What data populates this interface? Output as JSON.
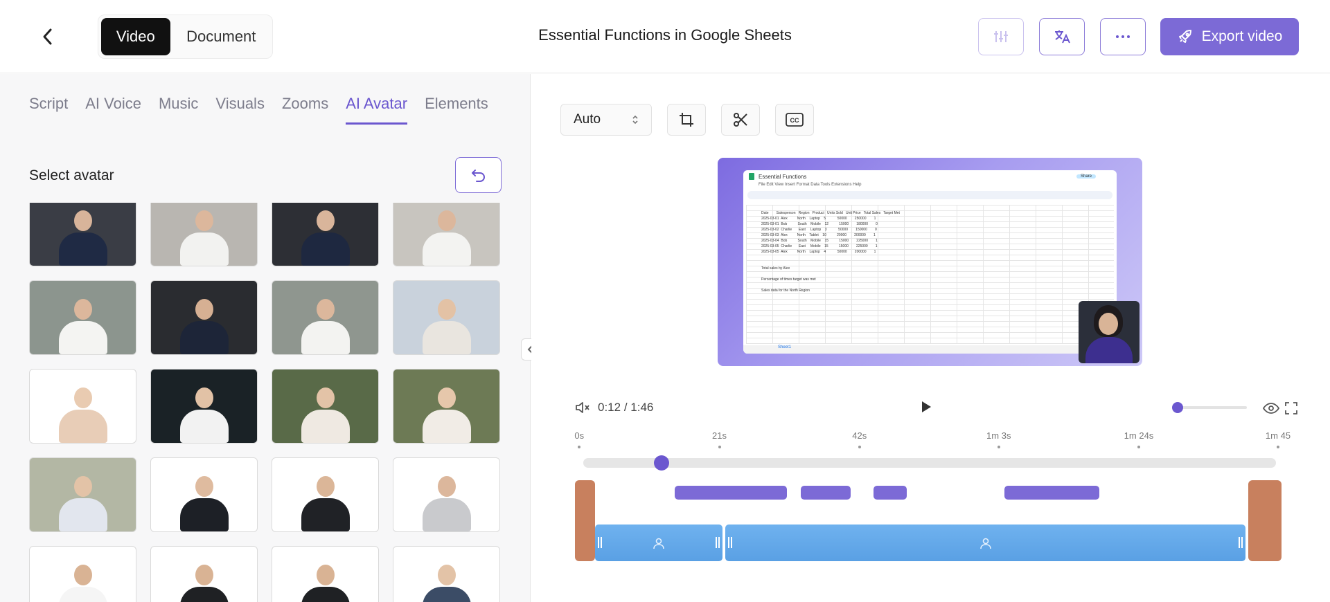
{
  "header": {
    "mode_video": "Video",
    "mode_document": "Document",
    "title": "Essential Functions in Google Sheets",
    "export_label": "Export video"
  },
  "tabs": [
    "Script",
    "AI Voice",
    "Music",
    "Visuals",
    "Zooms",
    "AI Avatar",
    "Elements"
  ],
  "active_tab": "AI Avatar",
  "panel": {
    "section_label": "Select avatar"
  },
  "avatars": [
    {
      "bg": "#3a3d45",
      "body": "#1f2a44",
      "head": "#d8b49a"
    },
    {
      "bg": "#b9b6b1",
      "body": "#f2f2f0",
      "head": "#dcb79c"
    },
    {
      "bg": "#2d2f35",
      "body": "#1e2840",
      "head": "#d9b59b"
    },
    {
      "bg": "#c8c5bf",
      "body": "#f3f3f1",
      "head": "#dcb79c"
    },
    {
      "bg": "#8c958e",
      "body": "#f4f4f2",
      "head": "#dcb79c"
    },
    {
      "bg": "#2a2c30",
      "body": "#1d2538",
      "head": "#d6b093"
    },
    {
      "bg": "#8f968f",
      "body": "#f3f3f1",
      "head": "#dcb79c"
    },
    {
      "bg": "#c9d2dc",
      "body": "#e9e5df",
      "head": "#e3c2a5"
    },
    {
      "bg": "#ffffff",
      "body": "#e8cdb7",
      "head": "#e9cbb1"
    },
    {
      "bg": "#1a2226",
      "body": "#f2f2f2",
      "head": "#e2c2a6"
    },
    {
      "bg": "#596a48",
      "body": "#efe9e2",
      "head": "#e3c3a7"
    },
    {
      "bg": "#6d7a55",
      "body": "#f1ece6",
      "head": "#e6c7ab"
    },
    {
      "bg": "#b3b7a4",
      "body": "#e2e6ee",
      "head": "#e3c3a7"
    },
    {
      "bg": "#ffffff",
      "body": "#1d2026",
      "head": "#dfbb9f"
    },
    {
      "bg": "#ffffff",
      "body": "#202226",
      "head": "#dbb698"
    },
    {
      "bg": "#ffffff",
      "body": "#c9cacd",
      "head": "#dcb79c"
    },
    {
      "bg": "#ffffff",
      "body": "#f5f5f5",
      "head": "#d9b394"
    },
    {
      "bg": "#ffffff",
      "body": "#1f2124",
      "head": "#d9b394"
    },
    {
      "bg": "#ffffff",
      "body": "#1f2124",
      "head": "#d9b394"
    },
    {
      "bg": "#ffffff",
      "body": "#3b4c66",
      "head": "#e3c3a7"
    }
  ],
  "editor": {
    "aspect_value": "Auto",
    "cc_label": "CC",
    "current_time": "0:12",
    "total_time": "1:46",
    "time_separator": "/",
    "playback_progress": 0.113,
    "volume_level": 0.0
  },
  "sheet_preview": {
    "doc_title": "Essential Functions",
    "share_label": "Share",
    "menu": "File  Edit  View  Insert  Format  Data  Tools  Extensions  Help",
    "rows": [
      "Date        Salesperson   Region   Product   Units Sold   Unit Price   Total Sales   Target Met",
      "2025-03-01  Alex          North    Laptop    5            50000        250000        1",
      "2025-03-01  Bob           South    Mobile    12           15000        180000        0",
      "2025-03-02  Charlie       East     Laptop    3            50000        150000        0",
      "2025-03-03  Alex          North    Tablet    10           20000        200000        1",
      "2025-03-04  Bob           South    Mobile    15           15000        225000        1",
      "2025-03-05  Charlie       East     Mobile    15           15000        225000        1",
      "2025-03-05  Alex          North    Laptop    4            50000        200000        1",
      "",
      "",
      "Total sales by Alex",
      "",
      "Percentage of times target was met",
      "",
      "Sales data for the North Region"
    ],
    "sheet_tab": "Sheet1"
  },
  "timeline": {
    "ticks": [
      {
        "label": "0s",
        "pos": 0.005
      },
      {
        "label": "21s",
        "pos": 0.166
      },
      {
        "label": "42s",
        "pos": 0.327
      },
      {
        "label": "1m 3s",
        "pos": 0.487
      },
      {
        "label": "1m 24s",
        "pos": 0.648
      },
      {
        "label": "1m 45",
        "pos": 0.808
      }
    ],
    "purple_segments": [
      {
        "start": 0.115,
        "end": 0.244
      },
      {
        "start": 0.26,
        "end": 0.318
      },
      {
        "start": 0.344,
        "end": 0.382
      },
      {
        "start": 0.495,
        "end": 0.604
      }
    ],
    "blue_segments": [
      {
        "start": 0.023,
        "end": 0.173
      },
      {
        "start": 0.173,
        "end": 0.776
      }
    ],
    "orange_segments": [
      {
        "start": 0.0,
        "end": 0.023
      },
      {
        "start": 0.776,
        "end": 0.814
      }
    ]
  },
  "colors": {
    "accent": "#6b57cf",
    "export_bg": "#7c6ad6",
    "clip_blue": "#62a8ea",
    "clip_orange": "#c8805e"
  }
}
